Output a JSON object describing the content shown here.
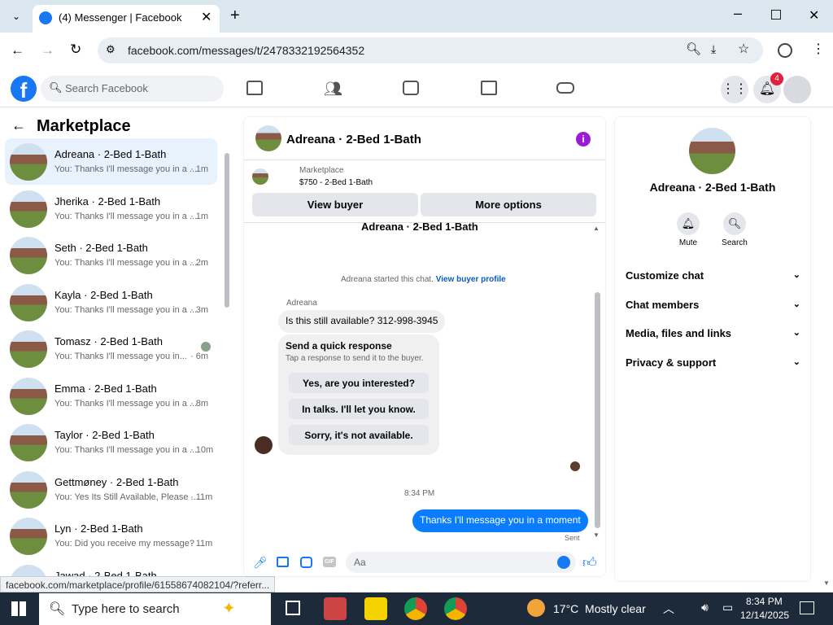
{
  "browser": {
    "tab_title": "(4) Messenger | Facebook",
    "url": "facebook.com/messages/t/2478332192564352",
    "status_url": "facebook.com/marketplace/profile/61558674082104/?referr..."
  },
  "fb": {
    "search_placeholder": "Search Facebook",
    "notif_count": "4",
    "brand_color": "#1877f2"
  },
  "left": {
    "title": "Marketplace",
    "items": [
      {
        "name": "Adreana · 2-Bed 1-Bath",
        "snippet": "You: Thanks I'll message you in a ...",
        "time": "· 1m"
      },
      {
        "name": "Jherika · 2-Bed 1-Bath",
        "snippet": "You: Thanks I'll message you in a ...",
        "time": "· 1m"
      },
      {
        "name": "Seth · 2-Bed 1-Bath",
        "snippet": "You: Thanks I'll message you in a ...",
        "time": "· 2m"
      },
      {
        "name": "Kayla · 2-Bed 1-Bath",
        "snippet": "You: Thanks I'll message you in a ...",
        "time": "· 3m"
      },
      {
        "name": "Tomasz · 2-Bed 1-Bath",
        "snippet": "You: Thanks I'll message you in...",
        "time": "· 6m"
      },
      {
        "name": "Emma · 2-Bed 1-Bath",
        "snippet": "You: Thanks I'll message you in a ...",
        "time": "· 8m"
      },
      {
        "name": "Taylor · 2-Bed 1-Bath",
        "snippet": "You: Thanks I'll message you in a ...",
        "time": "· 10m"
      },
      {
        "name": "Gettmøney · 2-Bed 1-Bath",
        "snippet": "You: Yes Its Still Available, Please ...",
        "time": "· 11m"
      },
      {
        "name": "Lyn · 2-Bed 1-Bath",
        "snippet": "You: Did you receive my message?",
        "time": "· 11m"
      },
      {
        "name": "Jawad · 2-Bed 1-Bath",
        "snippet": "",
        "time": ""
      }
    ]
  },
  "chat": {
    "header_name": "Adreana · 2-Bed 1-Bath",
    "listing_label": "Marketplace",
    "listing_detail": "$750 - 2-Bed 1-Bath",
    "view_buyer": "View buyer",
    "more_options": "More options",
    "top_name": "Adreana · 2-Bed 1-Bath",
    "started_text": "Adreana started this chat.",
    "view_profile": "View buyer profile",
    "sender": "Adreana",
    "incoming_msg": "Is this still available? 312-998-3945",
    "quick_title": "Send a quick response",
    "quick_sub": "Tap a response to send it to the buyer.",
    "quick_responses": [
      "Yes, are you interested?",
      "In talks. I'll let you know.",
      "Sorry, it's not available."
    ],
    "timestamp": "8:34 PM",
    "outgoing_msg": "Thanks I'll message you in a moment",
    "sent": "Sent",
    "input_placeholder": "Aa"
  },
  "right": {
    "name": "Adreana · 2-Bed 1-Bath",
    "mute": "Mute",
    "search": "Search",
    "rows": [
      "Customize chat",
      "Chat members",
      "Media, files and links",
      "Privacy & support"
    ]
  },
  "taskbar": {
    "search_placeholder": "Type here to search",
    "weather": "17°C  Mostly clear",
    "time": "8:34 PM",
    "date": "12/14/2025"
  }
}
